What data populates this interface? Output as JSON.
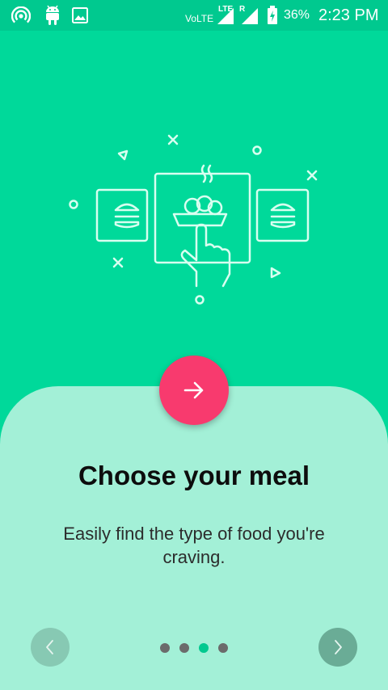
{
  "status_bar": {
    "volte": "VoLTE",
    "lte": "LTE",
    "roaming": "R",
    "battery": "36%",
    "time": "2:23 PM"
  },
  "onboarding": {
    "title": "Choose your meal",
    "description": "Easily find the type of food you're craving.",
    "page_count": 4,
    "active_page": 3
  },
  "colors": {
    "hero_bg": "#00d99a",
    "card_bg": "#a3f0d7",
    "accent": "#f83a6e",
    "active_dot": "#00c98f"
  }
}
